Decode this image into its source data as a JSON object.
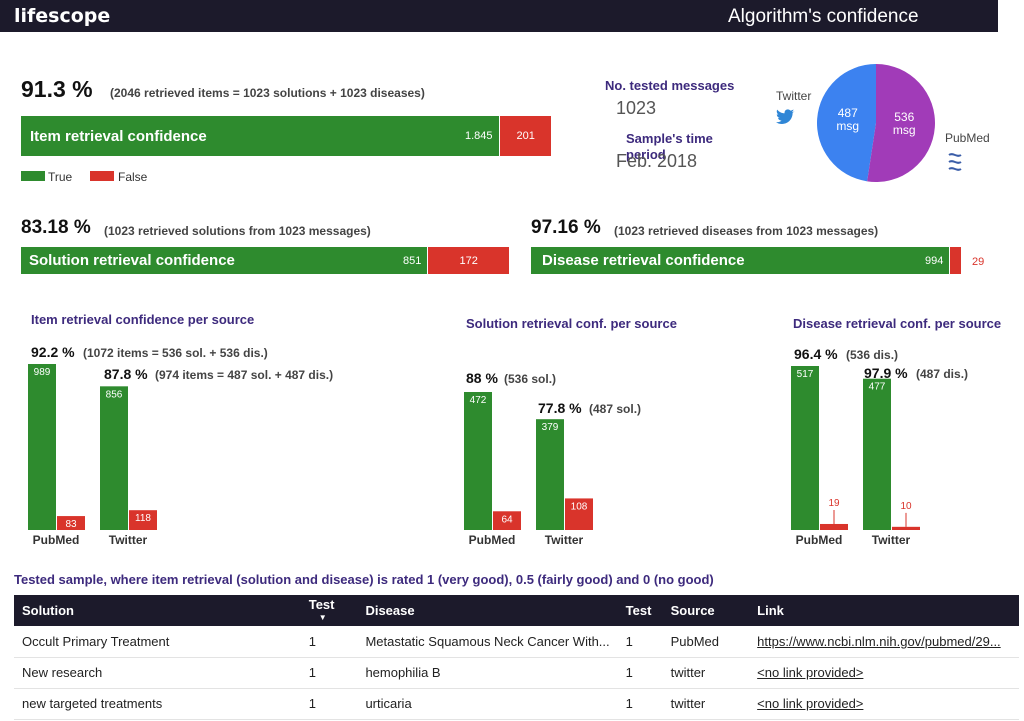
{
  "header": {
    "brand": "lifescope",
    "title": "Algorithm's confidence"
  },
  "overall": {
    "pct": "91.3 %",
    "note": "(2046 retrieved items = 1023 solutions + 1023 diseases)",
    "bar_label": "Item retrieval confidence",
    "true_label": "1.845",
    "false_label": "201",
    "true_value": 1845,
    "false_value": 201
  },
  "legend": {
    "true": "True",
    "false": "False",
    "true_color": "#2e8b2e",
    "false_color": "#d9342b"
  },
  "meta": {
    "tested_label": "No. tested messages",
    "tested_value": "1023",
    "period_label": "Sample's time period",
    "period_value": "Feb. 2018"
  },
  "pie": {
    "slices": [
      {
        "source": "Twitter",
        "label": "487 msg",
        "value": 487,
        "color": "#3c82f0"
      },
      {
        "source": "PubMed",
        "label": "536 msg",
        "value": 536,
        "color": "#a13bb8"
      }
    ],
    "twitter_label": "Twitter",
    "pubmed_label": "PubMed",
    "twitter_icon": "twitter-bird-icon",
    "pubmed_icon": "pubmed-logo-icon"
  },
  "solution": {
    "pct": "83.18 %",
    "note": "(1023 retrieved solutions from 1023 messages)",
    "bar_label": "Solution retrieval confidence",
    "true_label": "851",
    "false_label": "172",
    "true_value": 851,
    "false_value": 172
  },
  "disease": {
    "pct": "97.16 %",
    "note": "(1023 retrieved diseases from 1023 messages)",
    "bar_label": "Disease retrieval confidence",
    "true_label": "994",
    "false_label": "29",
    "true_value": 994,
    "false_value": 29
  },
  "chart_data": [
    {
      "type": "bar",
      "title": "Item retrieval confidence per source",
      "categories": [
        "PubMed",
        "Twitter"
      ],
      "series": [
        {
          "values": [
            989,
            856
          ],
          "labels": [
            "989",
            "856"
          ]
        },
        {
          "values": [
            83,
            118
          ],
          "labels": [
            "83",
            "118"
          ]
        }
      ],
      "pcts": [
        "92.2 %",
        "87.8 %"
      ],
      "subs": [
        "(1072 items = 536 sol. + 536 dis.)",
        "(974 items = 487 sol. + 487 dis.)"
      ]
    },
    {
      "type": "bar",
      "title": "Solution retrieval conf. per source",
      "categories": [
        "PubMed",
        "Twitter"
      ],
      "series": [
        {
          "values": [
            472,
            379
          ],
          "labels": [
            "472",
            "379"
          ]
        },
        {
          "values": [
            64,
            108
          ],
          "labels": [
            "64",
            "108"
          ]
        }
      ],
      "pcts": [
        "88 %",
        "77.8 %"
      ],
      "subs": [
        "(536 sol.)",
        "(487 sol.)"
      ]
    },
    {
      "type": "bar",
      "title": "Disease retrieval conf. per source",
      "categories": [
        "PubMed",
        "Twitter"
      ],
      "series": [
        {
          "values": [
            517,
            477
          ],
          "labels": [
            "517",
            "477"
          ]
        },
        {
          "values": [
            19,
            10
          ],
          "labels": [
            "19",
            "10"
          ]
        }
      ],
      "pcts": [
        "96.4 %",
        "97.9 %"
      ],
      "subs": [
        "(536 dis.)",
        "(487 dis.)"
      ]
    }
  ],
  "table": {
    "title": "Tested sample, where item retrieval (solution and disease) is rated 1 (very good), 0.5 (fairly good) and 0 (no good)",
    "headers": [
      "Solution",
      "Test",
      "Disease",
      "Test",
      "Source",
      "Link"
    ],
    "sort_icon": "sort-desc-icon",
    "rows": [
      [
        "Occult Primary Treatment",
        "1",
        "Metastatic Squamous Neck Cancer With...",
        "1",
        "PubMed",
        "https://www.ncbi.nlm.nih.gov/pubmed/29..."
      ],
      [
        "New research",
        "1",
        "hemophilia B",
        "1",
        "twitter",
        "<no link provided>"
      ],
      [
        "new targeted treatments",
        "1",
        "urticaria",
        "1",
        "twitter",
        "<no link provided>"
      ]
    ]
  }
}
